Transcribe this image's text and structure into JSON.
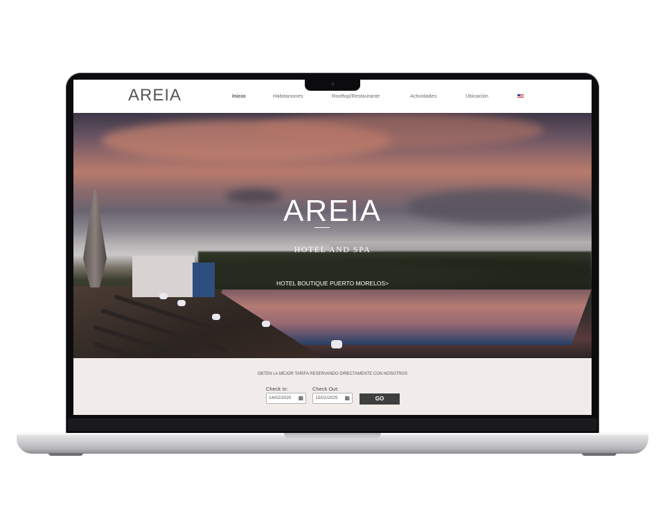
{
  "nav": {
    "logo": "AREIA",
    "items": [
      "Inicio",
      "Habitaciones",
      "Rooftop/Restaurante",
      "Actividades",
      "Ubicación"
    ],
    "language_flag": "us-flag-icon"
  },
  "hero": {
    "logo": "AREIA",
    "subtitle": "HOTEL AND SPA",
    "link": "HOTEL BOUTIQUE PUERTO MORELOS>"
  },
  "booking": {
    "promo": "OBTEN LA MEJOR TARIFA RESERVANDO DIRECTAMENTE CON NOSOTROS",
    "check_in_label": "Check In:",
    "check_in_value": "14/02/2025",
    "check_out_label": "Check Out:",
    "check_out_value": "15/02/2025",
    "go_label": "GO"
  },
  "colors": {
    "go_button": "#3f3f3f",
    "booking_bg": "#f1ece9"
  }
}
